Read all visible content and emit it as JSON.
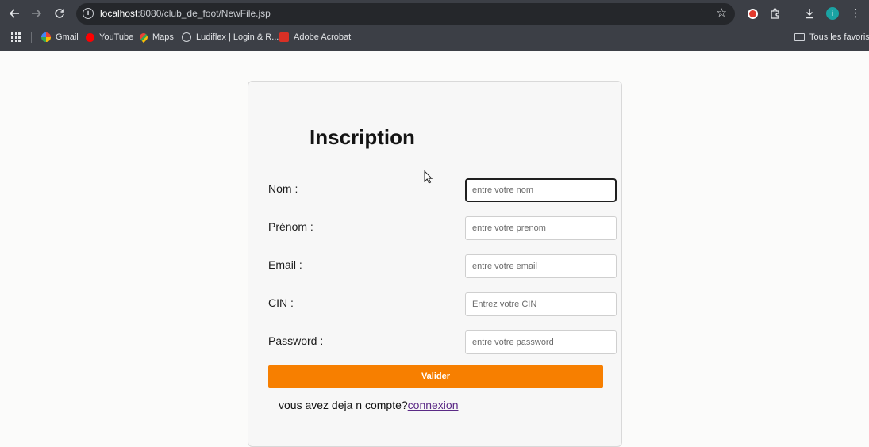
{
  "browser": {
    "url_host": "localhost",
    "url_path": ":8080/club_de_foot/NewFile.jsp",
    "bookmarks": [
      {
        "label": "Gmail",
        "icon": "gmail-icon"
      },
      {
        "label": "YouTube",
        "icon": "youtube-icon"
      },
      {
        "label": "Maps",
        "icon": "maps-icon"
      },
      {
        "label": "Ludiflex | Login & R...",
        "icon": "globe-icon"
      },
      {
        "label": "Adobe Acrobat",
        "icon": "acrobat-icon"
      }
    ],
    "all_bookmarks_label": "Tous les favoris",
    "profile_initial": "i"
  },
  "form": {
    "title": "Inscription",
    "fields": [
      {
        "label": "Nom :",
        "placeholder": "entre votre nom",
        "value": ""
      },
      {
        "label": "Prénom :",
        "placeholder": "entre votre prenom",
        "value": ""
      },
      {
        "label": "Email :",
        "placeholder": "entre votre email",
        "value": ""
      },
      {
        "label": "CIN :",
        "placeholder": "Entrez votre CIN",
        "value": ""
      },
      {
        "label": "Password :",
        "placeholder": "entre votre password",
        "value": ""
      }
    ],
    "submit_label": "Valider",
    "footer_text": "vous avez deja n compte?",
    "footer_link": "connexion"
  },
  "colors": {
    "chrome_bg": "#3c3f46",
    "submit_bg": "#f77f00",
    "link": "#5b2a86"
  }
}
